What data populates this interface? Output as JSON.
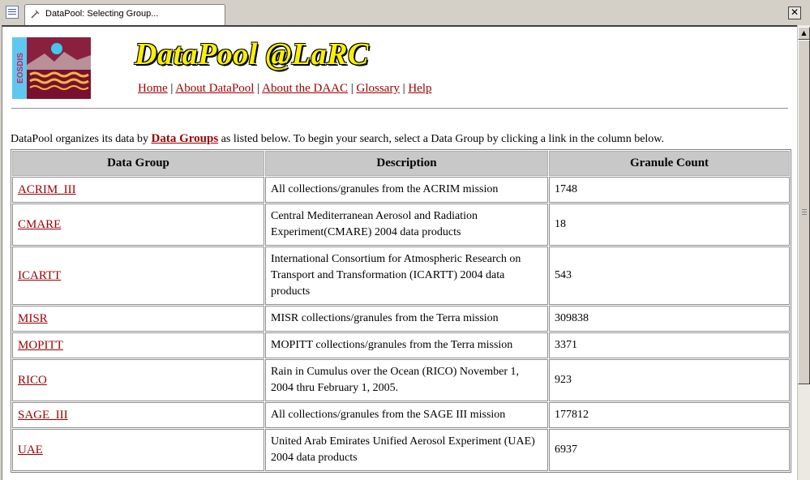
{
  "tab": {
    "title": "DataPool: Selecting Group..."
  },
  "header": {
    "site_title": "DataPool @LaRC",
    "logo_text": "EOSDIS",
    "nav": [
      "Home",
      "About DataPool",
      "About the DAAC",
      "Glossary",
      "Help"
    ],
    "nav_separator": "|"
  },
  "intro": {
    "before": "DataPool organizes its data by ",
    "link": "Data Groups",
    "after": " as listed below. To begin your search, select a Data Group by clicking a link in the column below."
  },
  "table": {
    "headers": [
      "Data Group",
      "Description",
      "Granule Count"
    ],
    "rows": [
      {
        "group": "ACRIM_III",
        "description": "All collections/granules from the ACRIM mission",
        "count": "1748"
      },
      {
        "group": "CMARE",
        "description": "Central Mediterranean Aerosol and Radiation Experiment(CMARE) 2004 data products",
        "count": "18"
      },
      {
        "group": "ICARTT",
        "description": "International Consortium for Atmospheric Research on Transport and Transformation (ICARTT) 2004 data products",
        "count": "543"
      },
      {
        "group": "MISR",
        "description": "MISR collections/granules from the Terra mission",
        "count": "309838"
      },
      {
        "group": "MOPITT",
        "description": "MOPITT collections/granules from the Terra mission",
        "count": "3371"
      },
      {
        "group": "RICO",
        "description": "Rain in Cumulus over the Ocean (RICO) November 1, 2004 thru February 1, 2005.",
        "count": "923"
      },
      {
        "group": "SAGE_III",
        "description": "All collections/granules from the SAGE III mission",
        "count": "177812"
      },
      {
        "group": "UAE",
        "description": "United Arab Emirates Unified Aerosol Experiment (UAE) 2004 data products",
        "count": "6937"
      }
    ]
  },
  "colors": {
    "link": "#990000",
    "title": "#f7f000",
    "header_bg": "#c8c8c8"
  },
  "icons": {
    "app": "browser-window-icon",
    "tab": "page-icon",
    "close": "close-icon",
    "scroll": "chevron-up-icon"
  }
}
